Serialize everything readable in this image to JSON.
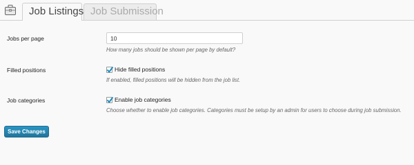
{
  "tabs": [
    {
      "label": "Job Listings",
      "active": true
    },
    {
      "label": "Job Submission",
      "active": false
    }
  ],
  "settings": {
    "jobs_per_page": {
      "label": "Jobs per page",
      "value": "10",
      "description": "How many jobs should be shown per page by default?"
    },
    "filled_positions": {
      "label": "Filled positions",
      "checkbox_label": "Hide filled positions",
      "checked": true,
      "description": "If enabled, filled positions will be hidden from the job list."
    },
    "job_categories": {
      "label": "Job categories",
      "checkbox_label": "Enable job categories",
      "checked": true,
      "description": "Choose whether to enable job categories. Categories must be setup by an admin for users to choose during job submission."
    }
  },
  "save_button": {
    "label": "Save Changes"
  },
  "icons": {
    "page_icon": "briefcase-icon",
    "checkbox_mark": "checkmark-icon"
  },
  "colors": {
    "primary_button": "#21759b",
    "background": "#f9f9f9"
  }
}
